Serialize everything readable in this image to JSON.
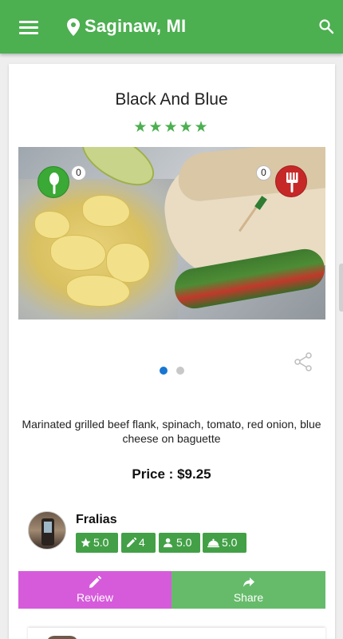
{
  "app_bar": {
    "location": "Saginaw, MI",
    "icons": {
      "menu": "menu-icon",
      "location": "location-pin-icon",
      "search": "search-icon"
    }
  },
  "dish": {
    "name": "Black And Blue",
    "rating_stars": 5,
    "stars_text": "★★★★★",
    "photo": {
      "total_images": 2,
      "active_index": 0,
      "like_count": "0",
      "dislike_count": "0",
      "like_icon": "spoon-icon",
      "dislike_icon": "fork-icon"
    },
    "description": "Marinated grilled beef flank, spinach, tomato, red onion, blue cheese on baguette",
    "price_text": "Price : $9.25"
  },
  "reviewer": {
    "name": "Fralias",
    "stats": {
      "rating": "5.0",
      "reviews": "4",
      "follow": "5.0",
      "dish": "5.0"
    }
  },
  "actions": {
    "review_label": "Review",
    "share_label": "Share"
  },
  "colors": {
    "primary": "#4caf50",
    "review_button": "#d65bdb",
    "share_button": "#66bb6a",
    "like_badge": "#3aa935",
    "dislike_badge": "#c62828",
    "stat_badge": "#43a047",
    "active_dot": "#1976d2"
  }
}
